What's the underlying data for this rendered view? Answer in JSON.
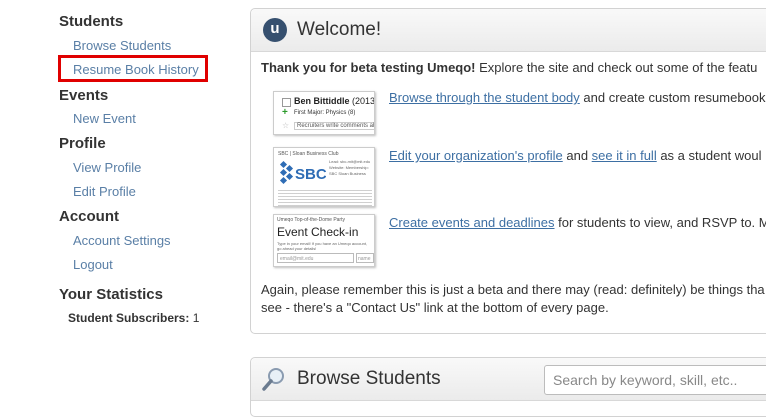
{
  "sidebar": {
    "students": {
      "title": "Students",
      "items": [
        "Browse Students",
        "Resume Book History"
      ]
    },
    "events": {
      "title": "Events",
      "items": [
        "New Event"
      ]
    },
    "profile": {
      "title": "Profile",
      "items": [
        "View Profile",
        "Edit Profile"
      ]
    },
    "account": {
      "title": "Account",
      "items": [
        "Account Settings",
        "Logout"
      ]
    },
    "statistics": {
      "title": "Your Statistics",
      "subscribers_label": "Student Subscribers:",
      "subscribers_value": "1"
    },
    "highlight_color": "#e00000"
  },
  "welcome": {
    "title": "Welcome!",
    "icon_letter": "u",
    "intro_bold": "Thank you for beta testing Umeqo!",
    "intro_rest": " Explore the site and check out some of the featu",
    "features": [
      {
        "link1": "Browse through the student body",
        "text1": " and create custom resumebook"
      },
      {
        "link1": "Edit your organization's profile",
        "text1": " and ",
        "link2": "see it in full",
        "text2": " as a student woul"
      },
      {
        "link1": "Create events and deadlines",
        "text1": " for students to view, and RSVP to. M"
      }
    ],
    "outro": "Again, please remember this is just a beta and there may (read: definitely) be things tha see - there's a \"Contact Us\" link at the bottom of every page.",
    "thumb_student": {
      "name": "Ben Bittiddle",
      "year": "(2013",
      "major": "First Major: Physics (8)",
      "note": "Recruiters write comments abou"
    },
    "thumb_org": {
      "header": "SBC | Sloan Business Club",
      "logo": "SBC",
      "side": "Lead: sbc-mit@mit.edu Website: Membership: SBC Sloan Business"
    },
    "thumb_event": {
      "top": "Umeqo Top-of-the-Dome Party",
      "title": "Event Check-in",
      "sub": "Type in your email! If you have an Umeqo account, go ahead your details!",
      "email_placeholder": "email@mit.edu",
      "name_placeholder": "name"
    }
  },
  "browse": {
    "title": "Browse Students",
    "search_placeholder": "Search by keyword, skill, etc.."
  },
  "colors": {
    "link": "#3d6fa3",
    "sidebar_link": "#5a7fa6",
    "umeqo_icon_bg": "#36506f"
  }
}
